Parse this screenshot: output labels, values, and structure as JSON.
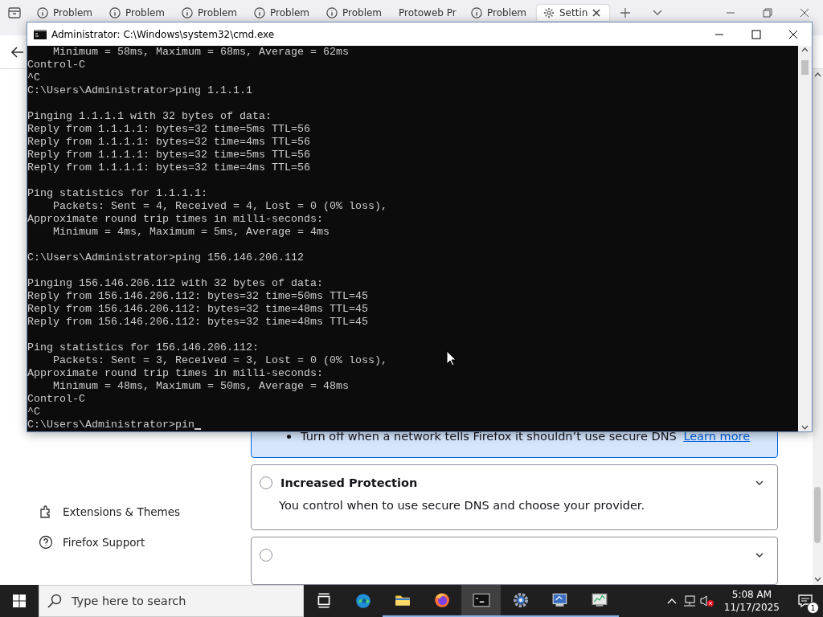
{
  "browser": {
    "tabs": [
      {
        "kind": "info",
        "label": "Problem",
        "selected": false
      },
      {
        "kind": "info",
        "label": "Problem",
        "selected": false
      },
      {
        "kind": "info",
        "label": "Problem",
        "selected": false
      },
      {
        "kind": "info",
        "label": "Problem",
        "selected": false
      },
      {
        "kind": "info",
        "label": "Problem",
        "selected": false
      },
      {
        "kind": "plain",
        "label": "Protoweb Pr",
        "selected": false
      },
      {
        "kind": "info",
        "label": "Problem",
        "selected": false
      },
      {
        "kind": "settings",
        "label": "Settin",
        "selected": true
      }
    ],
    "sidebar": {
      "items": [
        {
          "kind": "puzzle",
          "label": "Extensions & Themes"
        },
        {
          "kind": "help",
          "label": "Firefox Support"
        }
      ]
    },
    "dns_options": [
      {
        "kind": "expanded",
        "bullet": "Turn off when a network tells Firefox it shouldn’t use secure DNS",
        "link": "Learn more",
        "selected": true
      },
      {
        "kind": "collapsed",
        "title": "Increased Protection",
        "description": "You control when to use secure DNS and choose your provider.",
        "selected": false
      },
      {
        "kind": "cut",
        "selected": false
      }
    ]
  },
  "console": {
    "title": "Administrator: C:\\Windows\\system32\\cmd.exe",
    "blocks": [
      [
        "    Minimum = 58ms, Maximum = 68ms, Average = 62ms",
        "Control-C",
        "^C",
        "C:\\Users\\Administrator>ping 1.1.1.1"
      ],
      [
        "Pinging 1.1.1.1 with 32 bytes of data:",
        "Reply from 1.1.1.1: bytes=32 time=5ms TTL=56",
        "Reply from 1.1.1.1: bytes=32 time=4ms TTL=56",
        "Reply from 1.1.1.1: bytes=32 time=5ms TTL=56",
        "Reply from 1.1.1.1: bytes=32 time=4ms TTL=56"
      ],
      [
        "Ping statistics for 1.1.1.1:",
        "    Packets: Sent = 4, Received = 4, Lost = 0 (0% loss),",
        "Approximate round trip times in milli-seconds:",
        "    Minimum = 4ms, Maximum = 5ms, Average = 4ms"
      ],
      [
        "C:\\Users\\Administrator>ping 156.146.206.112"
      ],
      [
        "Pinging 156.146.206.112 with 32 bytes of data:",
        "Reply from 156.146.206.112: bytes=32 time=50ms TTL=45",
        "Reply from 156.146.206.112: bytes=32 time=48ms TTL=45",
        "Reply from 156.146.206.112: bytes=32 time=48ms TTL=45"
      ],
      [
        "Ping statistics for 156.146.206.112:",
        "    Packets: Sent = 3, Received = 3, Lost = 0 (0% loss),",
        "Approximate round trip times in milli-seconds:",
        "    Minimum = 48ms, Maximum = 50ms, Average = 48ms",
        "Control-C",
        "^C",
        "C:\\Users\\Administrator>pin"
      ]
    ]
  },
  "taskbar": {
    "search": {
      "placeholder": "Type here to search"
    },
    "apps": [
      {
        "kind": "task-view",
        "running": false,
        "selected": false
      },
      {
        "kind": "edge",
        "running": false,
        "selected": false
      },
      {
        "kind": "folder",
        "running": true,
        "selected": false
      },
      {
        "kind": "firefox",
        "running": true,
        "selected": false
      },
      {
        "kind": "terminal",
        "running": true,
        "selected": true
      },
      {
        "kind": "gear",
        "running": true,
        "selected": false
      },
      {
        "kind": "monitor",
        "running": true,
        "selected": false
      },
      {
        "kind": "chart",
        "running": true,
        "selected": false
      }
    ],
    "clock": {
      "time": "5:08 AM",
      "date": "11/17/2025"
    },
    "notifications": {
      "count": "1"
    }
  }
}
